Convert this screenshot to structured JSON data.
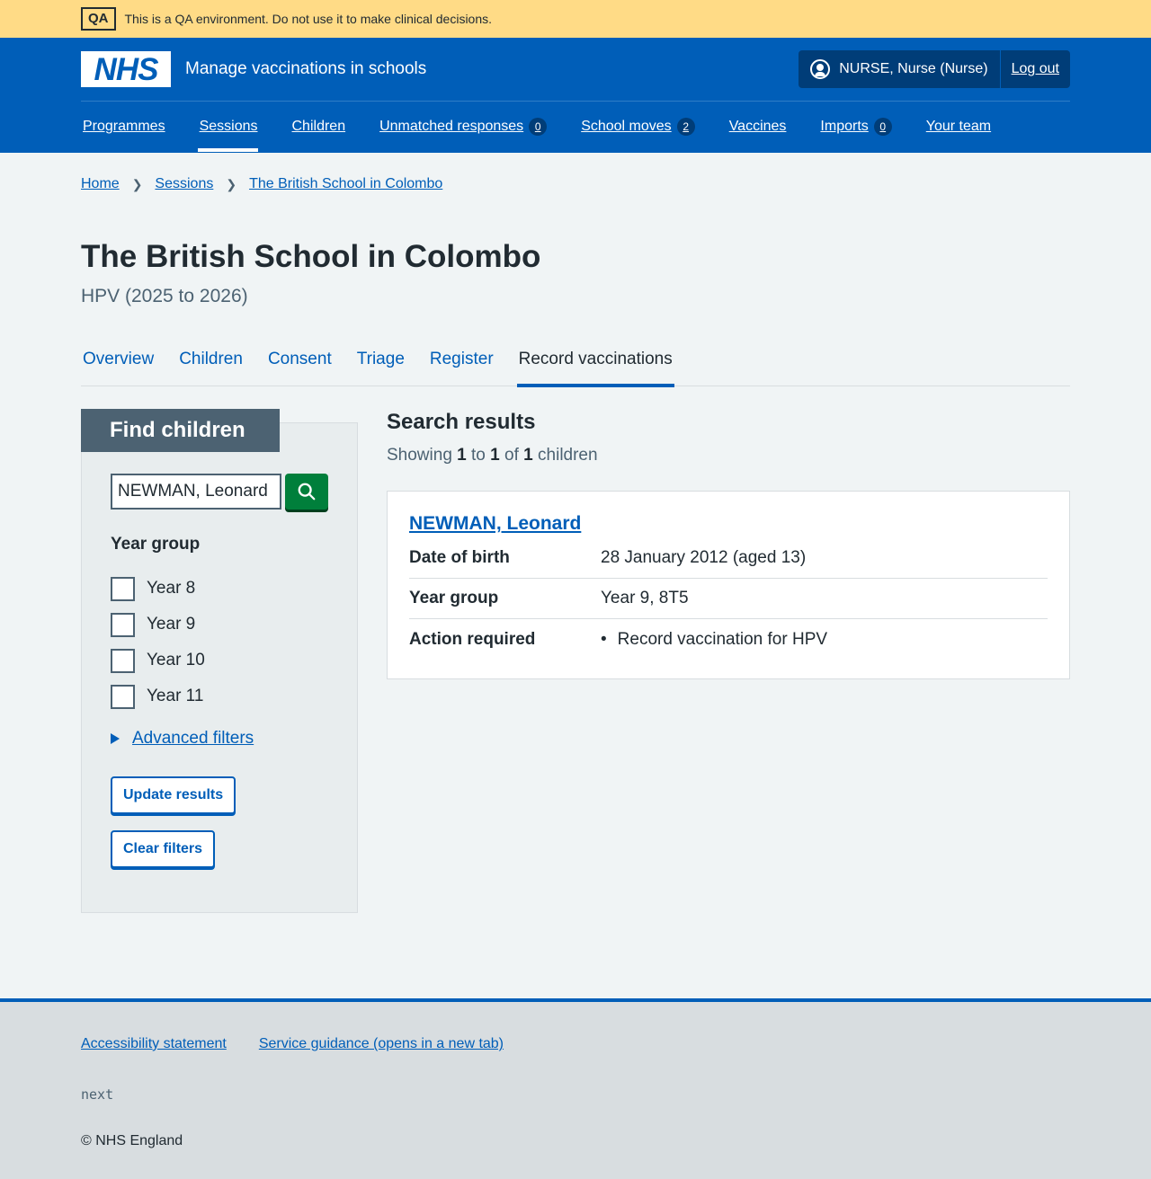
{
  "qa_banner": {
    "tag": "QA",
    "message": "This is a QA environment. Do not use it to make clinical decisions."
  },
  "header": {
    "logo": "NHS",
    "service_name": "Manage vaccinations in schools",
    "user": "NURSE, Nurse (Nurse)",
    "logout": "Log out"
  },
  "nav": {
    "items": [
      {
        "label": "Programmes"
      },
      {
        "label": "Sessions",
        "active": true
      },
      {
        "label": "Children"
      },
      {
        "label": "Unmatched responses",
        "badge": "0"
      },
      {
        "label": "School moves",
        "badge": "2"
      },
      {
        "label": "Vaccines"
      },
      {
        "label": "Imports",
        "badge": "0"
      },
      {
        "label": "Your team"
      }
    ]
  },
  "breadcrumb": [
    "Home",
    "Sessions",
    "The British School in Colombo"
  ],
  "page": {
    "title": "The British School in Colombo",
    "caption": "HPV (2025 to 2026)"
  },
  "tabs": [
    "Overview",
    "Children",
    "Consent",
    "Triage",
    "Register",
    "Record vaccinations"
  ],
  "active_tab": "Record vaccinations",
  "filter": {
    "heading": "Find children",
    "search_value": "NEWMAN, Leonard",
    "year_group_label": "Year group",
    "year_groups": [
      "Year 8",
      "Year 9",
      "Year 10",
      "Year 11"
    ],
    "advanced": "Advanced filters",
    "update": "Update results",
    "clear": "Clear filters"
  },
  "results": {
    "title": "Search results",
    "showing": "Showing",
    "from": "1",
    "to_word": "to",
    "to": "1",
    "of_word": "of",
    "total": "1",
    "unit": "children",
    "child": {
      "name": "NEWMAN, Leonard",
      "rows": [
        {
          "key": "Date of birth",
          "value": "28 January 2012 (aged 13)"
        },
        {
          "key": "Year group",
          "value": "Year 9, 8T5"
        },
        {
          "key": "Action required",
          "value": "Record vaccination for HPV"
        }
      ]
    }
  },
  "footer": {
    "links": [
      "Accessibility statement",
      "Service guidance (opens in a new tab)"
    ],
    "version": "next",
    "copyright": "© NHS England"
  },
  "colors": {
    "nhs_blue": "#005eb8",
    "qa_yellow": "#ffdb86",
    "search_green": "#007f3b"
  }
}
